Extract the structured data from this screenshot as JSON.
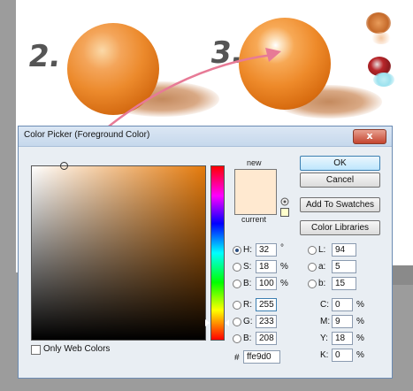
{
  "canvas": {
    "label_2": "2.",
    "label_3": "3."
  },
  "dialog": {
    "title": "Color Picker (Foreground Color)",
    "close_label": "x",
    "new_label": "new",
    "current_label": "current",
    "new_color": "#ffe9d0",
    "current_color": "#ffe9d0",
    "buttons": {
      "ok": "OK",
      "cancel": "Cancel",
      "add_to_swatches": "Add To Swatches",
      "color_libraries": "Color Libraries"
    },
    "only_web_colors": "Only Web Colors",
    "hsb": {
      "h_label": "H:",
      "h_value": "32",
      "h_unit": "°",
      "s_label": "S:",
      "s_value": "18",
      "s_unit": "%",
      "b_label": "B:",
      "b_value": "100",
      "b_unit": "%"
    },
    "lab": {
      "l_label": "L:",
      "l_value": "94",
      "a_label": "a:",
      "a_value": "5",
      "b_label": "b:",
      "b_value": "15"
    },
    "rgb": {
      "r_label": "R:",
      "r_value": "255",
      "g_label": "G:",
      "g_value": "233",
      "b_label": "B:",
      "b_value": "208"
    },
    "cmyk": {
      "c_label": "C:",
      "c_value": "0",
      "c_unit": "%",
      "m_label": "M:",
      "m_value": "9",
      "m_unit": "%",
      "y_label": "Y:",
      "y_value": "18",
      "y_unit": "%",
      "k_label": "K:",
      "k_value": "0",
      "k_unit": "%"
    },
    "hex_label": "#",
    "hex_value": "ffe9d0",
    "field_hue_color": "#e47a0c"
  }
}
